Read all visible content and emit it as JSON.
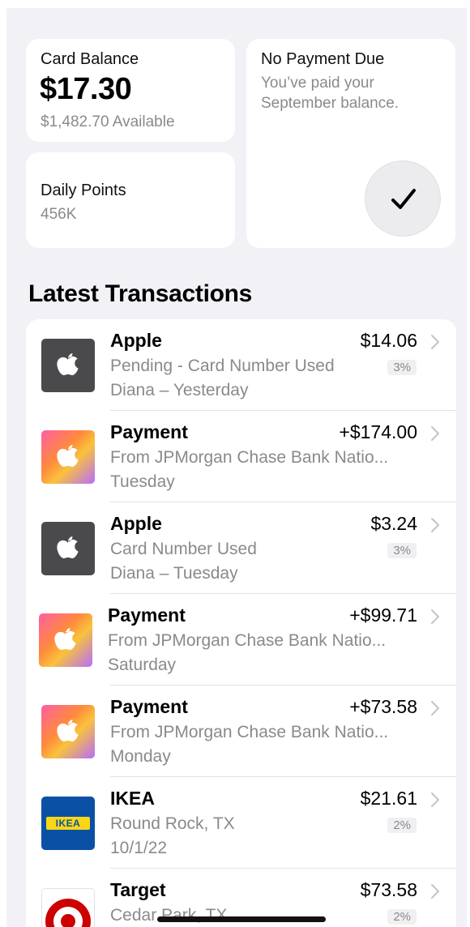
{
  "balance": {
    "label": "Card Balance",
    "amount": "$17.30",
    "available": "$1,482.70 Available"
  },
  "points": {
    "label": "Daily Points",
    "value": "456K"
  },
  "payment": {
    "title": "No Payment Due",
    "description": "You’ve paid your September balance."
  },
  "transactions": {
    "title": "Latest Transactions",
    "items": [
      {
        "icon": "apple-logo-icon",
        "name": "Apple",
        "line1": "Pending - Card Number Used",
        "line2": "Diana – Yesterday",
        "amount": "$14.06",
        "badge": "3%"
      },
      {
        "icon": "apple-logo-icon",
        "name": "Payment",
        "line1": "From JPMorgan Chase Bank Natio...",
        "line2": "Tuesday",
        "amount": "+$174.00"
      },
      {
        "icon": "apple-logo-icon",
        "name": "Apple",
        "line1": "Card Number Used",
        "line2": "Diana – Tuesday",
        "amount": "$3.24",
        "badge": "3%"
      },
      {
        "icon": "apple-logo-icon",
        "name": "Payment",
        "line1": "From JPMorgan Chase Bank Natio...",
        "line2": "Saturday",
        "amount": "+$99.71"
      },
      {
        "icon": "apple-logo-icon",
        "name": "Payment",
        "line1": "From JPMorgan Chase Bank Natio...",
        "line2": "Monday",
        "amount": "+$73.58"
      },
      {
        "icon": "ikea-logo-icon",
        "logo_text": "IKEA",
        "name": "IKEA",
        "line1": "Round Rock, TX",
        "line2": "10/1/22",
        "amount": "$21.61",
        "badge": "2%"
      },
      {
        "icon": "target-logo-icon",
        "name": "Target",
        "line1": "Cedar Park, TX",
        "amount": "$73.58",
        "badge": "2%"
      }
    ]
  },
  "colors": {
    "screen_background": "#f1f1f6",
    "card_background": "#ffffff",
    "secondary_text": "#8a8a8e",
    "target_red": "#cc0000",
    "ikea_blue": "#0a51a6",
    "ikea_yellow": "#f9d616"
  }
}
